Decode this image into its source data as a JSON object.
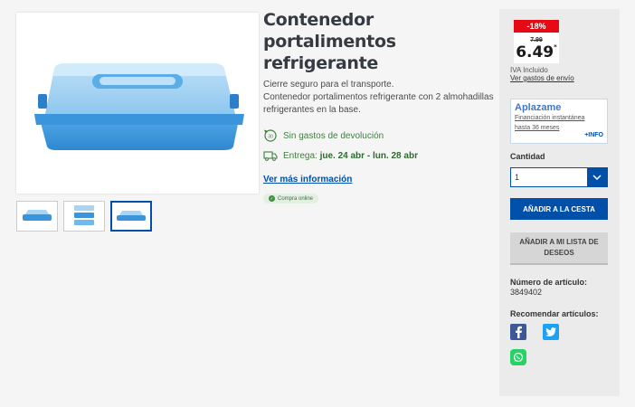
{
  "product": {
    "title": "Contenedor portalimentos refrigerante",
    "description_line1": "Cierre seguro para el transporte.",
    "description_line2": "Contenedor portalimentos refrigerante con 2 almohadillas refrigerantes en la base.",
    "return_text": "Sin gastos de devolución",
    "delivery_prefix": "Entrega: ",
    "delivery_dates": "jue. 24 abr - lun. 28 abr",
    "more_info_link": "Ver más información",
    "online_badge": "Compra online",
    "thumbnails_count": 3,
    "active_thumbnail": 2
  },
  "pricing": {
    "discount": "-18%",
    "old_price": "7.99",
    "price": "6.49",
    "price_mark": "*",
    "vat_text": "IVA Incluido",
    "shipping_link": "Ver gastos de envío"
  },
  "aplazame": {
    "logo": "Aplazame",
    "text": "Financiación instantánea hasta 36 meses",
    "info": "+INFO"
  },
  "quantity": {
    "label": "Cantidad",
    "value": "1"
  },
  "buttons": {
    "add_to_cart": "AÑADIR A LA CESTA",
    "add_to_wishlist": "AÑADIR A MI LISTA DE DESEOS"
  },
  "article": {
    "label": "Número de artículo:",
    "number": "3849402"
  },
  "share": {
    "label": "Recomendar artículos:"
  },
  "colors": {
    "brand_blue": "#0050aa",
    "discount_red": "#e60a14",
    "green": "#3f7f3f"
  }
}
